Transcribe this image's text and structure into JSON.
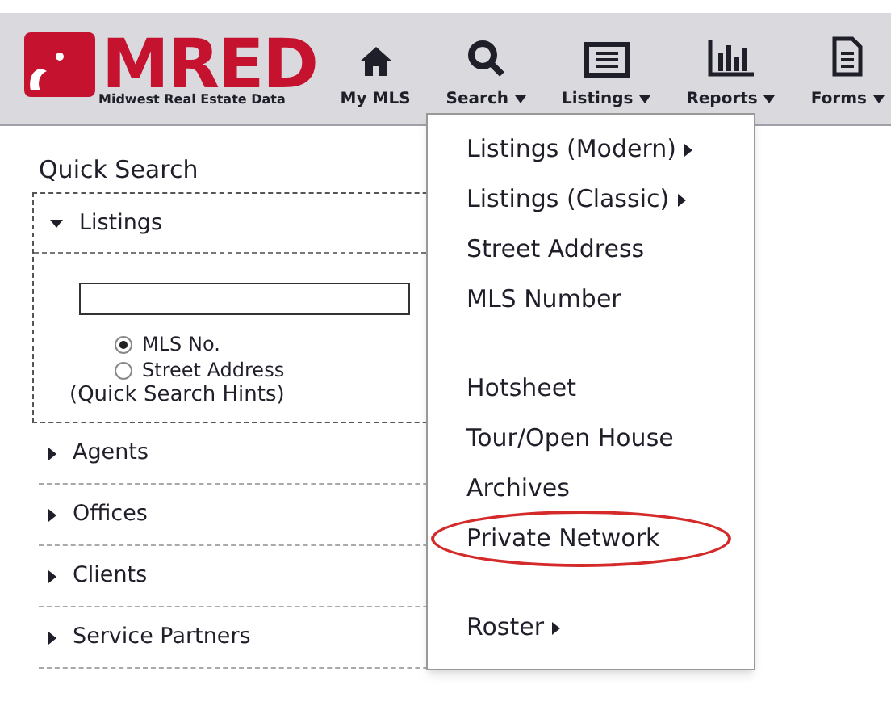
{
  "logo": {
    "title": "MRED",
    "subtitle": "Midwest Real Estate Data"
  },
  "nav": [
    {
      "label": "My MLS",
      "dropdown": false
    },
    {
      "label": "Search",
      "dropdown": true
    },
    {
      "label": "Listings",
      "dropdown": true
    },
    {
      "label": "Reports",
      "dropdown": true
    },
    {
      "label": "Forms",
      "dropdown": true
    }
  ],
  "quick_search": {
    "title": "Quick Search",
    "sections": [
      {
        "label": "Listings",
        "expanded": true
      },
      {
        "label": "Agents",
        "expanded": false
      },
      {
        "label": "Offices",
        "expanded": false
      },
      {
        "label": "Clients",
        "expanded": false
      },
      {
        "label": "Service Partners",
        "expanded": false
      }
    ],
    "options": [
      {
        "label": "MLS No.",
        "selected": true
      },
      {
        "label": "Street Address",
        "selected": false
      }
    ],
    "hints_link": "(Quick Search Hints)"
  },
  "search_menu": {
    "groups": [
      [
        {
          "label": "Listings (Modern)",
          "submenu": true,
          "highlighted": false
        },
        {
          "label": "Listings (Classic)",
          "submenu": true,
          "highlighted": false
        },
        {
          "label": "Street Address",
          "submenu": false,
          "highlighted": false
        },
        {
          "label": "MLS Number",
          "submenu": false,
          "highlighted": false
        }
      ],
      [
        {
          "label": "Hotsheet",
          "submenu": false,
          "highlighted": false
        },
        {
          "label": "Tour/Open House",
          "submenu": false,
          "highlighted": false
        },
        {
          "label": "Archives",
          "submenu": false,
          "highlighted": false
        },
        {
          "label": "Private Network",
          "submenu": false,
          "highlighted": true
        }
      ],
      [
        {
          "label": "Roster",
          "submenu": true,
          "highlighted": false
        }
      ]
    ]
  }
}
